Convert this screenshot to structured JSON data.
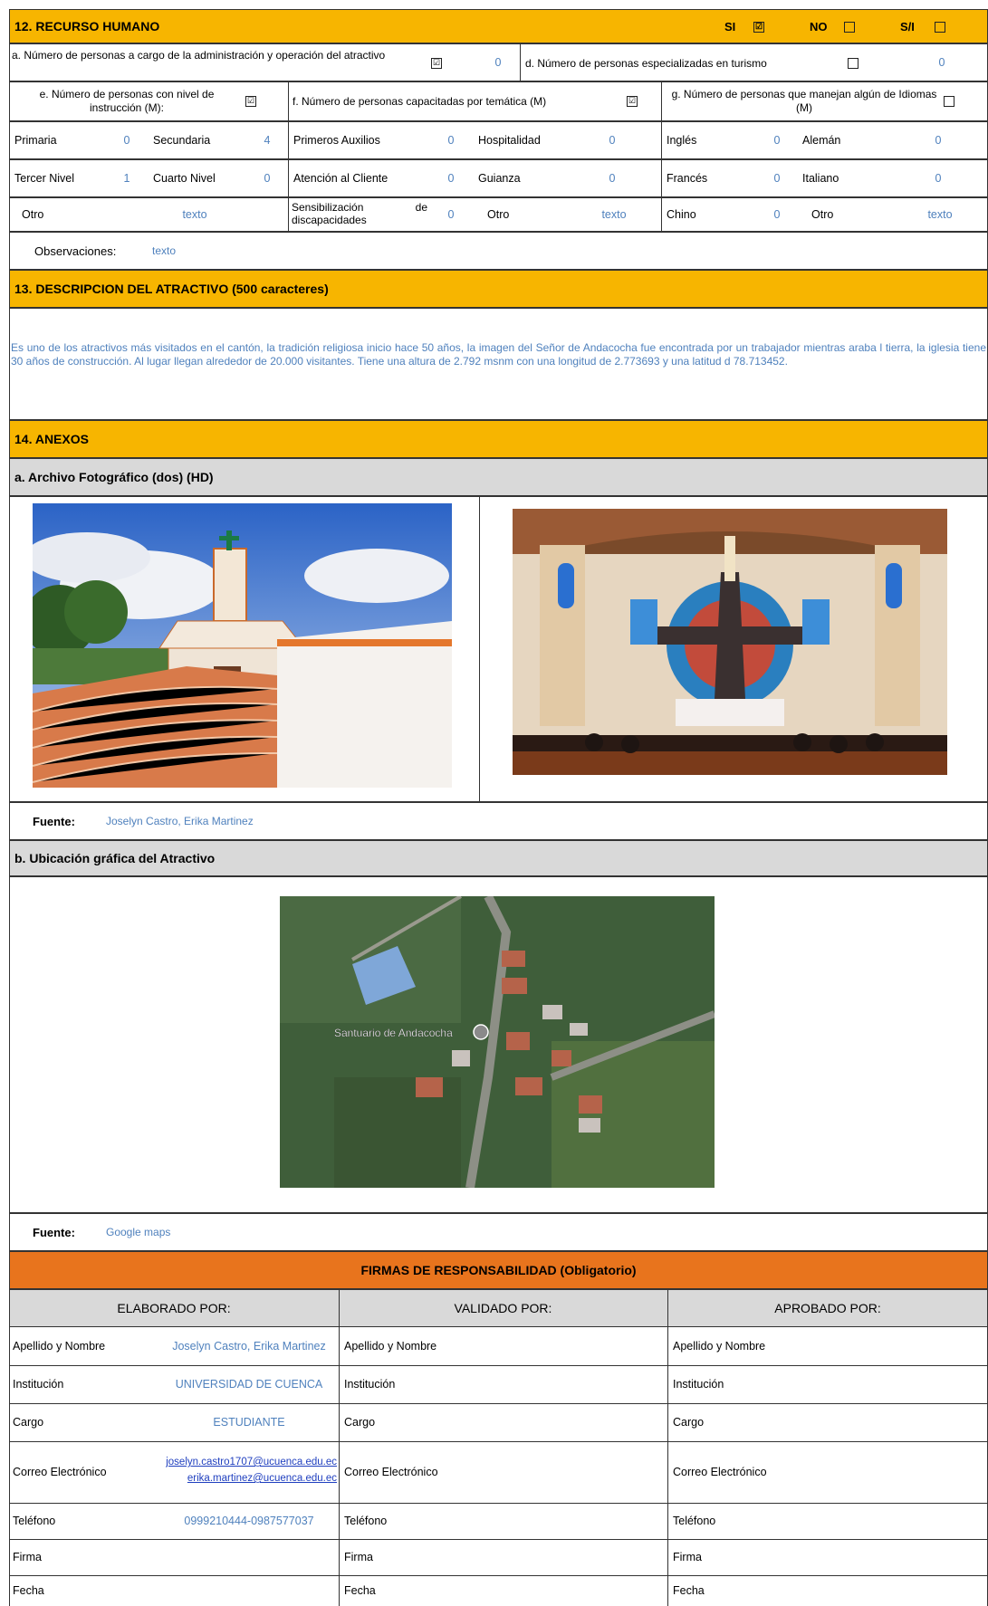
{
  "s12": {
    "title": "12. RECURSO HUMANO",
    "si": "SI",
    "no": "NO",
    "sn": "S/I",
    "si_mark": "☑",
    "no_mark": "",
    "sn_mark": "",
    "a_label": "a. Número de personas a cargo de la administración y operación del atractivo",
    "a_mark": "☑",
    "a_value": "0",
    "d_label": "d. Número de personas especializadas en turismo",
    "d_mark": "",
    "d_value": "0",
    "e_label": "e. Número de personas con nivel de instrucción (M):",
    "e_mark": "☑",
    "f_label": "f. Número de personas capacitadas por temática (M)",
    "f_mark": "☑",
    "g_label": "g. Número de personas que manejan algún de Idiomas (M)",
    "g_mark": "",
    "rows": [
      [
        [
          "Primaria",
          "0"
        ],
        [
          "Secundaria",
          "4"
        ],
        [
          "Primeros Auxilios",
          "0"
        ],
        [
          "Hospitalidad",
          "0"
        ],
        [
          "Inglés",
          "0"
        ],
        [
          "Alemán",
          "0"
        ]
      ],
      [
        [
          "Tercer Nivel",
          "1"
        ],
        [
          "Cuarto Nivel",
          "0"
        ],
        [
          "Atención al Cliente",
          "0"
        ],
        [
          "Guianza",
          "0"
        ],
        [
          "Francés",
          "0"
        ],
        [
          "Italiano",
          "0"
        ]
      ],
      [
        [
          "Otro",
          "texto"
        ],
        [
          "",
          ""
        ],
        [
          "Sensibilización de discapacidades",
          "0"
        ],
        [
          "Otro",
          "texto"
        ],
        [
          "Chino",
          "0"
        ],
        [
          "Otro",
          "texto"
        ]
      ]
    ],
    "obs_label": "Observaciones:",
    "obs_value": "texto"
  },
  "s13": {
    "title": "13. DESCRIPCION DEL ATRACTIVO (500 caracteres)",
    "text": "Es uno de los atractivos más visitados en el cantón, la tradición religiosa inicio hace 50 años, la imagen del Señor de Andacocha fue encontrada por un trabajador mientras araba l tierra, la iglesia tiene 30 años de construcción. Al lugar llegan alrededor de 20.000 visitantes. Tiene una altura de 2.792 msnm con una longitud de 2.773693 y una latitud d 78.713452."
  },
  "s14": {
    "title": "14. ANEXOS",
    "a_title": "a. Archivo Fotográfico (dos) (HD)",
    "fuente_label": "Fuente:",
    "fuente_a": "Joselyn Castro, Erika Martinez",
    "b_title": "b. Ubicación gráfica del Atractivo",
    "map_label": "Santuario de Andacocha",
    "fuente_b": "Google maps"
  },
  "firmas": {
    "title": "FIRMAS DE RESPONSABILIDAD (Obligatorio)",
    "cols": [
      "ELABORADO POR:",
      "VALIDADO  POR:",
      "APROBADO POR:"
    ],
    "labels": [
      "Apellido y Nombre",
      "Institución",
      "Cargo",
      "Correo Electrónico",
      "Teléfono",
      "Firma",
      "Fecha"
    ],
    "elaborado": {
      "nombre": "Joselyn Castro, Erika Martinez",
      "institucion": "UNIVERSIDAD DE CUENCA",
      "cargo": "ESTUDIANTE",
      "correo1": "joselyn.castro1707@ucuenca.edu.ec",
      "correo2": "erika.martinez@ucuenca.edu.ec",
      "telefono": "0999210444-0987577037"
    }
  },
  "colors": {
    "yellow": "#f7b500",
    "orange": "#e8741d",
    "gray": "#d9d9d9",
    "blue_text": "#4f81bd"
  }
}
